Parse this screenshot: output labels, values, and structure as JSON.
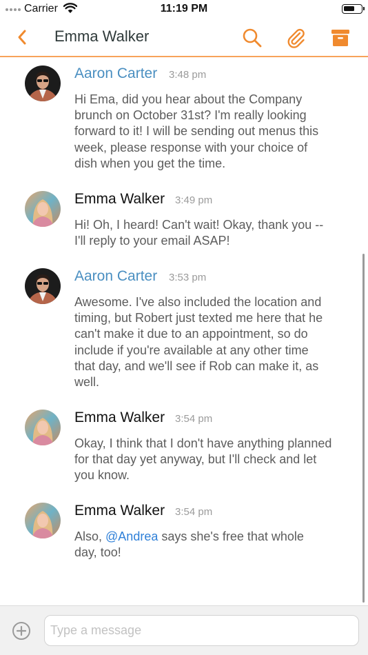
{
  "status_bar": {
    "carrier": "Carrier",
    "time": "11:19 PM"
  },
  "nav": {
    "title": "Emma Walker",
    "accent_color": "#f08a2e",
    "icons": [
      "back-chevron-icon",
      "search-icon",
      "paperclip-icon",
      "archive-box-icon"
    ]
  },
  "messages": [
    {
      "sender": "Aaron Carter",
      "time": "3:48 pm",
      "text": "Hi Ema, did you hear about the Company\nbrunch on October 31st? I'm really looking\nforward to it! I will be sending out menus this\nweek, please response with your choice of\ndish when you get the time."
    },
    {
      "sender": "Emma Walker",
      "time": "3:49 pm",
      "text": "Hi! Oh, I heard! Can't wait! Okay, thank you --\nI'll reply to your email ASAP!"
    },
    {
      "sender": "Aaron Carter",
      "time": "3:53 pm",
      "text": "Awesome. I've also included the location and\ntiming, but Robert just texted me here that he\ncan't make it due to an appointment, so do\ninclude if you're available at any other time\nthat day, and we'll see if Rob can make it, as\nwell."
    },
    {
      "sender": "Emma Walker",
      "time": "3:54 pm",
      "text": "Okay, I think that I don't have anything planned\nfor that day yet anyway, but I'll check and let\nyou know."
    },
    {
      "sender": "Emma Walker",
      "time": "3:54 pm",
      "mention": "@Andrea",
      "text": " says she's free that whole\nday, too!",
      "text_prefix": "Also, "
    }
  ],
  "composer": {
    "placeholder": "Type a message"
  },
  "colors": {
    "sender_link": "#4a8fc1",
    "mention": "#2f80d8",
    "divider": "#f7a25a"
  }
}
